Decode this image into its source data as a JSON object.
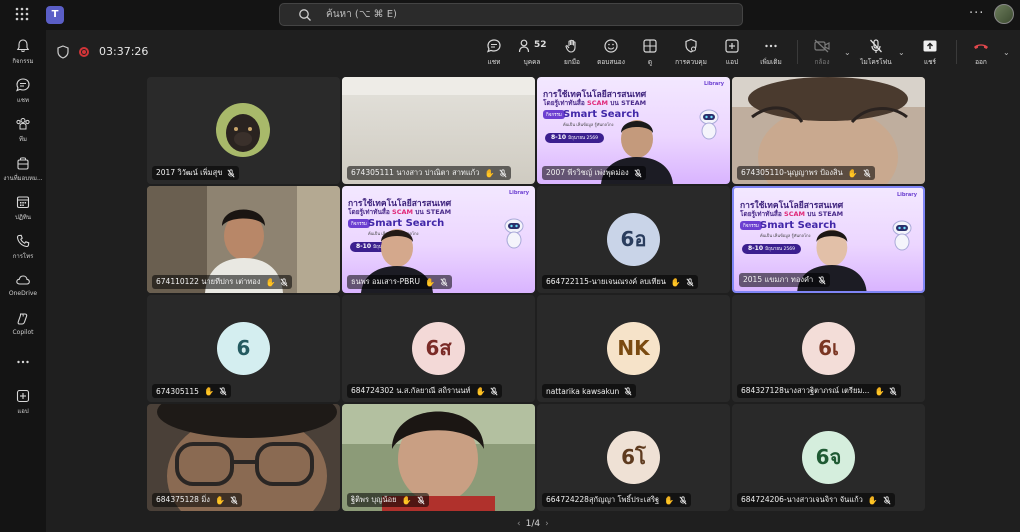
{
  "topbar": {
    "search_placeholder": "ค้นหา (⌥ ⌘ E)",
    "more_label": "···"
  },
  "rail": [
    {
      "label": "กิจกรรม",
      "icon": "bell-icon"
    },
    {
      "label": "แชท",
      "icon": "chat-icon"
    },
    {
      "label": "ทีม",
      "icon": "teams-icon"
    },
    {
      "label": "งานที่มอบหม...",
      "icon": "assignments-icon"
    },
    {
      "label": "ปฏิทิน",
      "icon": "calendar-icon"
    },
    {
      "label": "การโทร",
      "icon": "phone-icon"
    },
    {
      "label": "OneDrive",
      "icon": "cloud-icon"
    },
    {
      "label": "Copilot",
      "icon": "copilot-icon"
    },
    {
      "label": "",
      "icon": "more-apps-icon"
    },
    {
      "label": "แอป",
      "icon": "add-apps-icon"
    }
  ],
  "meeting": {
    "timer": "03:37:26",
    "participants_count": "52",
    "tools": {
      "chat": "แชท",
      "people": "บุคคล",
      "raise": "ยกมือ",
      "react": "ตอบสนอง",
      "view": "ดู",
      "control": "การควบคุม",
      "apps": "แอป",
      "more": "เพิ่มเติม",
      "camera": "กล้อง",
      "mic": "ไมโครโฟน",
      "share": "แชร์",
      "leave": "ออก"
    }
  },
  "banner": {
    "title": "การใช้เทคโนโลยีสารสนเทศ",
    "subtitle_prefix": "โดยรู้เท่าทันสื่อ",
    "scam": "SCAM",
    "subtitle_suffix": "บน STEAM",
    "pill": "กิจกรรม",
    "smart": "Smart Search",
    "smart_sub": "ค้นเป็น เห็นข้อมูล รู้ทันกลโกง",
    "date": "8-10",
    "date_month": "มิถุนายน 2569",
    "logo": "Library"
  },
  "tiles": [
    {
      "name": "2017 วิวัฒน์ เพิ่มสุข",
      "kind": "avatar-photo",
      "hand": false
    },
    {
      "name": "674305111 นางสาว ปาณิตา สาทแก้ว",
      "kind": "camera-ceiling",
      "hand": true
    },
    {
      "name": "2007 พีรวิชญ์ เพ่งพุดม่อง",
      "kind": "banner-person",
      "hand": false
    },
    {
      "name": "674305110-นุญญาพร ป้องสิน",
      "kind": "camera-face",
      "hand": true
    },
    {
      "name": "674110122 นายทีปกร เต่าทอง",
      "kind": "camera-man",
      "hand": true
    },
    {
      "name": "ธนพร อมเสาร-PBRU",
      "kind": "banner-woman",
      "hand": true
    },
    {
      "name": "664722115-นายเจนณรงค์ ลบเทียน",
      "initials": "6อ",
      "bg": "#c9d4e8",
      "fg": "#2a3d5e",
      "hand": true
    },
    {
      "name": "2015 แขมภา ทองคำ",
      "kind": "banner-woman2",
      "hand": false,
      "active": true
    },
    {
      "name": "674305115",
      "initials": "6",
      "bg": "#d4eef0",
      "fg": "#245a60",
      "hand": true
    },
    {
      "name": "684724302 น.ส.กัลยาณี สถิรานนท์",
      "initials": "6ส",
      "bg": "#f3d9d7",
      "fg": "#7a2b27",
      "hand": true
    },
    {
      "name": "nattarika kawsakun",
      "initials": "NK",
      "bg": "#f6e3c9",
      "fg": "#7a4a10",
      "hand": false
    },
    {
      "name": "684327128นางสาวฐิตาภรณ์ เตรียม...",
      "initials": "6เ",
      "bg": "#f3ddd8",
      "fg": "#7a3522",
      "hand": true
    },
    {
      "name": "684375128 มิ่ง",
      "kind": "camera-glasses",
      "hand": true
    },
    {
      "name": "ฐิติพร บุญน้อย",
      "kind": "camera-girl",
      "hand": true
    },
    {
      "name": "664724228สุกัญญา โพธิ์ประเสริฐ",
      "initials": "6โ",
      "bg": "#efe1d5",
      "fg": "#5e3a1e",
      "hand": true
    },
    {
      "name": "684724206-นางสาวเจนจิรา จันแก้ว",
      "initials": "6จ",
      "bg": "#d5eedd",
      "fg": "#1f5a33",
      "hand": true
    }
  ],
  "pager": {
    "text": "1/4"
  }
}
